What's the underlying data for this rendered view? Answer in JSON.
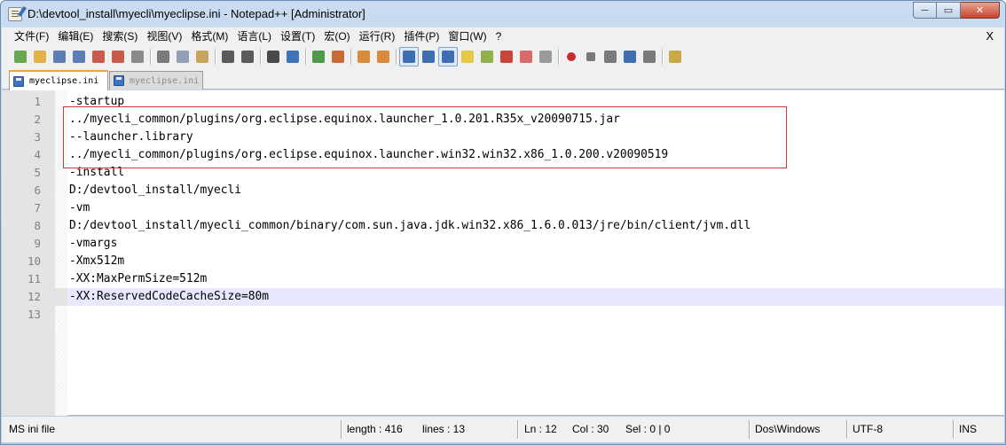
{
  "window": {
    "title": "D:\\devtool_install\\myecli\\myeclipse.ini - Notepad++ [Administrator]",
    "minimize": "─",
    "maximize": "▭",
    "close": "✕"
  },
  "menu": {
    "items": [
      "文件(F)",
      "编辑(E)",
      "搜索(S)",
      "视图(V)",
      "格式(M)",
      "语言(L)",
      "设置(T)",
      "宏(O)",
      "运行(R)",
      "插件(P)",
      "窗口(W)",
      "?"
    ],
    "close": "X"
  },
  "toolbar": {
    "icons": [
      {
        "name": "new-file-icon",
        "color": "#6aa84f"
      },
      {
        "name": "open-file-icon",
        "color": "#e2b34a"
      },
      {
        "name": "save-icon",
        "color": "#5b7fb5"
      },
      {
        "name": "save-all-icon",
        "color": "#5b7fb5"
      },
      {
        "name": "close-file-icon",
        "color": "#c95b4a"
      },
      {
        "name": "close-all-icon",
        "color": "#c95b4a"
      },
      {
        "name": "print-icon",
        "color": "#8a8a8a"
      },
      {
        "name": "cut-icon",
        "color": "#7a7a7a"
      },
      {
        "name": "copy-icon",
        "color": "#8f9fb6"
      },
      {
        "name": "paste-icon",
        "color": "#c9a45b"
      },
      {
        "name": "undo-icon",
        "color": "#5a5a5a"
      },
      {
        "name": "redo-icon",
        "color": "#5a5a5a"
      },
      {
        "name": "find-icon",
        "color": "#4a4a4a"
      },
      {
        "name": "replace-icon",
        "color": "#3f74b8"
      },
      {
        "name": "zoom-in-icon",
        "color": "#4f9a4a"
      },
      {
        "name": "zoom-out-icon",
        "color": "#c96a3a"
      },
      {
        "name": "sync-vertical-icon",
        "color": "#d98a3a"
      },
      {
        "name": "sync-horizontal-icon",
        "color": "#d98a3a"
      },
      {
        "name": "word-wrap-icon",
        "color": "#3f6fb0"
      },
      {
        "name": "show-all-chars-icon",
        "color": "#3f6fb0"
      },
      {
        "name": "indent-guide-icon",
        "color": "#3f6fb0"
      },
      {
        "name": "user-language-icon",
        "color": "#e6c84a"
      },
      {
        "name": "function-list-icon",
        "color": "#8fb04a"
      },
      {
        "name": "doc-map-icon",
        "color": "#c9453a"
      },
      {
        "name": "folder-workspace-icon",
        "color": "#d96a6a"
      },
      {
        "name": "monitoring-icon",
        "color": "#9a9a9a"
      },
      {
        "name": "record-macro-icon",
        "color": "#c92a2a"
      },
      {
        "name": "stop-macro-icon",
        "color": "#7a7a7a"
      },
      {
        "name": "play-macro-icon",
        "color": "#7a7a7a"
      },
      {
        "name": "run-macro-multiple-icon",
        "color": "#3f6fb0"
      },
      {
        "name": "save-macro-icon",
        "color": "#7a7a7a"
      },
      {
        "name": "plugin-icon",
        "color": "#c9a84a"
      }
    ]
  },
  "tabs": [
    {
      "label": "myeclipse.ini",
      "active": true
    },
    {
      "label": "myeclipse.ini",
      "active": false
    }
  ],
  "editor": {
    "current_line": 12,
    "lines": [
      {
        "num": "1",
        "text": "-startup"
      },
      {
        "num": "2",
        "text": "../myecli_common/plugins/org.eclipse.equinox.launcher_1.0.201.R35x_v20090715.jar"
      },
      {
        "num": "3",
        "text": "--launcher.library"
      },
      {
        "num": "4",
        "text": "../myecli_common/plugins/org.eclipse.equinox.launcher.win32.win32.x86_1.0.200.v20090519"
      },
      {
        "num": "5",
        "text": "-install"
      },
      {
        "num": "6",
        "text": "D:/devtool_install/myecli"
      },
      {
        "num": "7",
        "text": "-vm"
      },
      {
        "num": "8",
        "text": "D:/devtool_install/myecli_common/binary/com.sun.java.jdk.win32.x86_1.6.0.013/jre/bin/client/jvm.dll"
      },
      {
        "num": "9",
        "text": "-vmargs"
      },
      {
        "num": "10",
        "text": "-Xmx512m"
      },
      {
        "num": "11",
        "text": "-XX:MaxPermSize=512m"
      },
      {
        "num": "12",
        "text": "-XX:ReservedCodeCacheSize=80m"
      },
      {
        "num": "13",
        "text": ""
      }
    ]
  },
  "status": {
    "file_type": "MS ini file",
    "length": "length : 416",
    "lines": "lines : 13",
    "ln": "Ln : 12",
    "col": "Col : 30",
    "sel": "Sel : 0 | 0",
    "eol": "Dos\\Windows",
    "encoding": "UTF-8",
    "mode": "INS"
  }
}
